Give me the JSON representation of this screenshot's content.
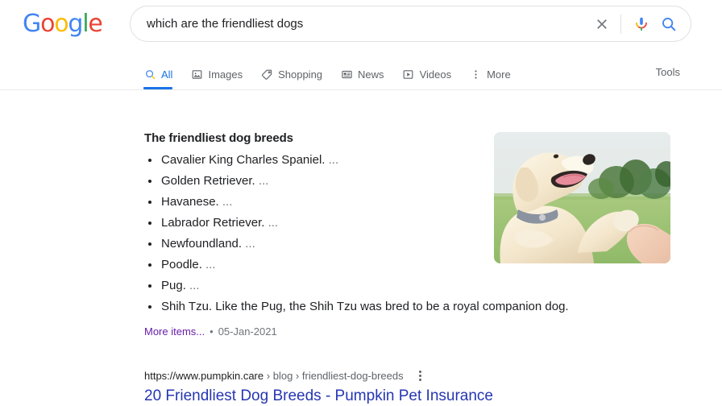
{
  "header": {
    "logo": {
      "name": "Google",
      "letters": [
        {
          "char": "G",
          "color": "#4285F4"
        },
        {
          "char": "o",
          "color": "#EA4335"
        },
        {
          "char": "o",
          "color": "#FBBC05"
        },
        {
          "char": "g",
          "color": "#4285F4"
        },
        {
          "char": "l",
          "color": "#34A853"
        },
        {
          "char": "e",
          "color": "#EA4335"
        }
      ]
    },
    "search": {
      "query": "which are the friendliest dogs",
      "placeholder": "Search",
      "clear_icon": "close-icon",
      "mic_icon": "microphone-icon",
      "search_icon": "search-icon"
    },
    "tabs": [
      {
        "label": "All",
        "icon": "search-icon",
        "active": true
      },
      {
        "label": "Images",
        "icon": "image-icon",
        "active": false
      },
      {
        "label": "Shopping",
        "icon": "tag-icon",
        "active": false
      },
      {
        "label": "News",
        "icon": "newspaper-icon",
        "active": false
      },
      {
        "label": "Videos",
        "icon": "play-box-icon",
        "active": false
      },
      {
        "label": "More",
        "icon": "more-vertical-icon",
        "active": false
      }
    ],
    "tools_label": "Tools"
  },
  "snippet": {
    "title": "The friendliest dog breeds",
    "items": [
      {
        "text": "Cavalier King Charles Spaniel.",
        "ellipsis": "..."
      },
      {
        "text": "Golden Retriever.",
        "ellipsis": "..."
      },
      {
        "text": "Havanese.",
        "ellipsis": "..."
      },
      {
        "text": "Labrador Retriever.",
        "ellipsis": "..."
      },
      {
        "text": "Newfoundland.",
        "ellipsis": "..."
      },
      {
        "text": "Poodle.",
        "ellipsis": "..."
      },
      {
        "text": "Pug.",
        "ellipsis": "..."
      },
      {
        "text": "Shih Tzu. Like the Pug, the Shih Tzu was bred to be a royal companion dog.",
        "ellipsis": ""
      }
    ],
    "more_items_label": "More items...",
    "separator": "•",
    "date": "05-Jan-2021",
    "thumbnail_alt": "golden retriever shaking hands with a person"
  },
  "result": {
    "url_domain": "https://www.pumpkin.care",
    "url_crumb1": "blog",
    "url_crumb2": "friendliest-dog-breeds",
    "url_separator": "›",
    "menu_icon": "kebab-menu-icon",
    "title": "20 Friendliest Dog Breeds - Pumpkin Pet Insurance"
  },
  "colors": {
    "google_blue": "#4285F4",
    "accent_blue": "#1a73e8",
    "link_blue": "#2636b1",
    "visited_purple": "#681da8",
    "text": "#202124",
    "muted": "#70757a"
  }
}
